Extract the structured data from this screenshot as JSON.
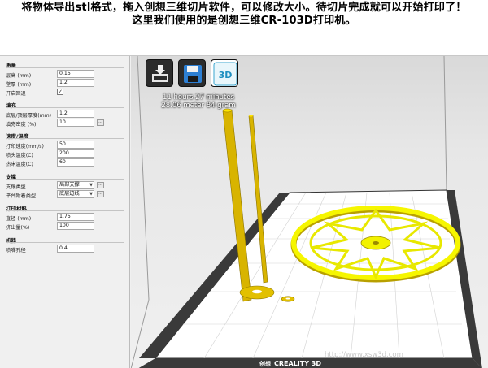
{
  "caption": {
    "line1": "将物体导出stl格式，拖入创想三维切片软件，可以修改大小。待切片完成就可以开始打印了！",
    "line2": "这里我们使用的是创想三维CR-103D打印机。"
  },
  "panel": {
    "quality": {
      "title": "质量",
      "layer_height_label": "层高 (mm)",
      "layer_height_value": "0.15",
      "shell_thickness_label": "壁厚 (mm)",
      "shell_thickness_value": "1.2",
      "retraction_label": "开启回退",
      "retraction_checked": "✓"
    },
    "fill": {
      "title": "填充",
      "top_bottom_label": "底层/顶层厚度(mm)",
      "top_bottom_value": "1.2",
      "density_label": "填充密度 (%)",
      "density_value": "10",
      "dots": "..."
    },
    "speed": {
      "title": "速度/温度",
      "print_speed_label": "打印速度(mm/s)",
      "print_speed_value": "50",
      "nozzle_temp_label": "喷头温度(C)",
      "nozzle_temp_value": "200",
      "bed_temp_label": "热床温度(C)",
      "bed_temp_value": "60"
    },
    "support": {
      "title": "支撑",
      "support_type_label": "支撑类型",
      "support_type_value": "局部支撑",
      "adhesion_label": "平台附着类型",
      "adhesion_value": "底层边线",
      "dots": "..."
    },
    "material": {
      "title": "打印材料",
      "diameter_label": "直径 (mm)",
      "diameter_value": "1.75",
      "flow_label": "挤出量(%)",
      "flow_value": "100"
    },
    "machine": {
      "title": "机器",
      "nozzle_label": "喷嘴孔径",
      "nozzle_value": "0.4"
    }
  },
  "viewport": {
    "print_time": "11 hours 27 minutes",
    "print_material": "28.06 meter 84 gram",
    "bed_brand": "CREALITY 3D",
    "bed_logo": "创想",
    "toolbar_icons": [
      "load-icon",
      "save-icon",
      "brand-icon"
    ],
    "brand_icon_text": "3D",
    "accent_color": "#e8e800"
  },
  "watermark": "http://www.xsw3d.com"
}
